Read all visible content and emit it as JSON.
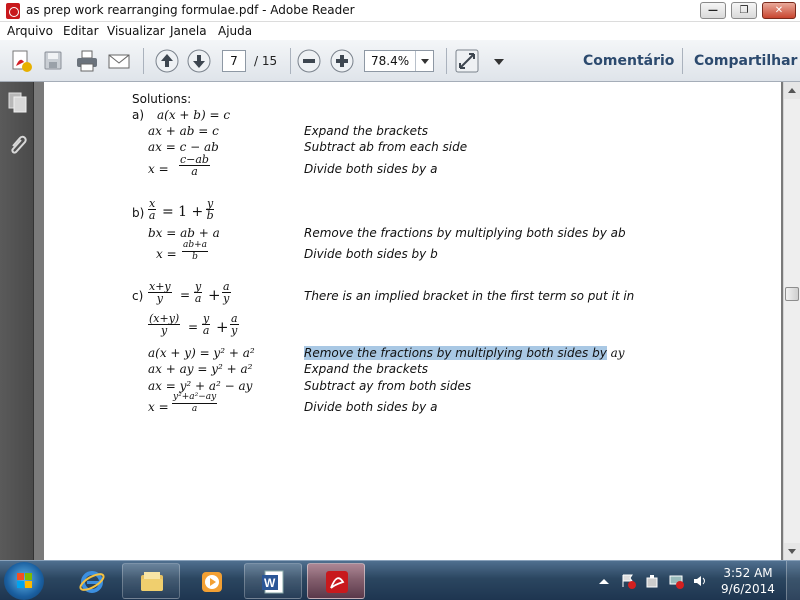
{
  "window": {
    "title": "as prep work rearranging formulae.pdf - Adobe Reader",
    "minimize_glyph": "—",
    "maximize_glyph": "❐",
    "close_glyph": "✕"
  },
  "menu": {
    "items": [
      "Arquivo",
      "Editar",
      "Visualizar",
      "Janela",
      "Ajuda"
    ]
  },
  "toolbar": {
    "page_current": "7",
    "page_total": "/ 15",
    "zoom": "78.4%",
    "comment_label": "Comentário",
    "share_label": "Compartilhar",
    "icons": [
      "create-pdf-icon",
      "save-icon",
      "print-icon",
      "email-icon",
      "previous-page-icon",
      "next-page-icon",
      "zoom-out-icon",
      "zoom-in-icon",
      "fit-page-icon",
      "toolbar-menu-icon"
    ]
  },
  "nav_panel": {
    "icons": [
      "pages-panel-icon",
      "attachments-icon"
    ]
  },
  "document": {
    "heading": "Solutions:",
    "part_a": {
      "label": "a)",
      "line1": "a(x + b) = c",
      "line2": "ax + ab = c",
      "line3": "ax = c − ab",
      "line4_lhs": "x =",
      "line4_num": "c−ab",
      "line4_den": "a",
      "desc2": "Expand the brackets",
      "desc3": "Subtract ab from each side",
      "desc4": "Divide both sides by a"
    },
    "part_b": {
      "label": "b)",
      "line1_num": "x",
      "line1_den": "a",
      "line1_mid": "= 1 +",
      "line1_rnum": "y",
      "line1_rden": "b",
      "line2": "bx = ab + a",
      "line3_lhs": "x =",
      "line3_num": "ab+a",
      "line3_den": "b",
      "desc2": "Remove the fractions by multiplying both sides by ab",
      "desc3": "Divide both sides by b"
    },
    "part_c": {
      "label": "c)",
      "line1_num": "x+y",
      "line1_den": "y",
      "line1_eq": "=",
      "line1_f2num": "y",
      "line1_f2den": "a",
      "line1_plus": "+",
      "line1_f3num": "a",
      "line1_f3den": "y",
      "line2_num": "(x+y)",
      "line2_den": "y",
      "line2_eq": "=",
      "line2_f2num": "y",
      "line2_f2den": "a",
      "line2_plus": "+",
      "line2_f3num": "a",
      "line2_f3den": "y",
      "line3": "a(x + y) = y² + a²",
      "line4": "ax + ay = y² + a²",
      "line5": "ax = y² + a² − ay",
      "line6_lhs": "x =",
      "line6_num": "y²+a²−ay",
      "line6_den": "a",
      "desc1": "There is an implied bracket in the first term so put it in",
      "desc3_highlighted": "Remove the fractions by multiplying both sides by",
      "desc3_tail": "ay",
      "desc4": "Expand the brackets",
      "desc5": "Subtract ay from both sides",
      "desc6": "Divide both sides by  a"
    }
  },
  "taskbar": {
    "apps": [
      "internet-explorer-icon",
      "windows-explorer-icon",
      "media-player-icon",
      "word-icon",
      "adobe-reader-icon"
    ],
    "tray_icons": [
      "show-hidden-icons-icon",
      "action-center-icon",
      "power-icon",
      "network-icon",
      "volume-icon"
    ],
    "time": "3:52 AM",
    "date": "9/6/2014"
  }
}
